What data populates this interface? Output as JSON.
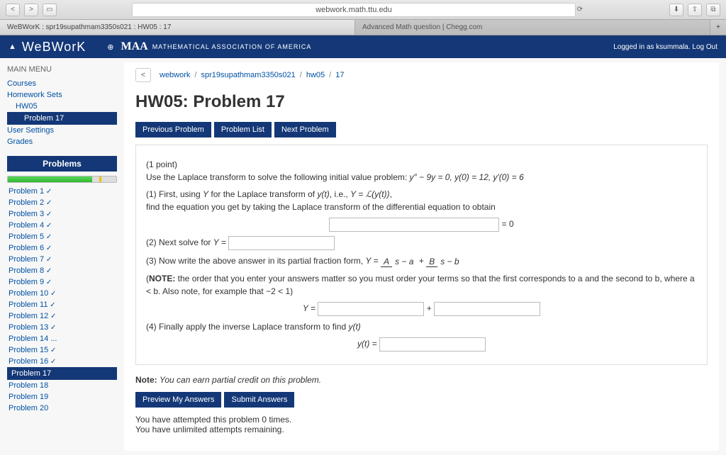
{
  "safari": {
    "url": "webwork.math.ttu.edu"
  },
  "tabs": {
    "t1": "WeBWorK : spr19supathmam3350s021 : HW05 : 17",
    "t2": "Advanced Math question | Chegg.com"
  },
  "header": {
    "logo": "WeBWorK",
    "maa": "MAA",
    "maaSub": "MATHEMATICAL ASSOCIATION OF AMERICA",
    "right": "Logged in as ksummala.    Log Out"
  },
  "breadcrumb": {
    "a": "webwork",
    "b": "spr19supathmam3350s021",
    "c": "hw05",
    "d": "17"
  },
  "title": "HW05: Problem 17",
  "nav": {
    "prev": "Previous Problem",
    "list": "Problem List",
    "next": "Next Problem"
  },
  "sidebar": {
    "mainmenu": "MAIN MENU",
    "courses": "Courses",
    "hwsets": "Homework Sets",
    "hw05": "HW05",
    "p17": "Problem 17",
    "usersettings": "User Settings",
    "grades": "Grades",
    "problemsHdr": "Problems"
  },
  "problems": {
    "p1": "Problem 1",
    "p2": "Problem 2",
    "p3": "Problem 3",
    "p4": "Problem 4",
    "p5": "Problem 5",
    "p6": "Problem 6",
    "p7": "Problem 7",
    "p8": "Problem 8",
    "p9": "Problem 9",
    "p10": "Problem 10",
    "p11": "Problem 11",
    "p12": "Problem 12",
    "p13": "Problem 13",
    "p14": "Problem 14",
    "p15": "Problem 15",
    "p16": "Problem 16",
    "p17": "Problem 17",
    "p18": "Problem 18",
    "p19": "Problem 19",
    "p20": "Problem 20"
  },
  "body": {
    "points": "(1 point)",
    "intro1": "Use the Laplace transform to solve the following initial value problem: ",
    "eq1": "y″ − 9y = 0,        y(0) = 12,  y′(0) = 6",
    "step1a": "(1) First, using ",
    "step1b": " for the Laplace transform of ",
    "step1c": ", i.e., ",
    "step1eq": "Y = ℒ(y(t))",
    "step1d": ",",
    "step1e": "find the equation you get by taking the Laplace transform of the differential equation to obtain",
    "eqzero": " = 0",
    "step2": "(2) Next solve for ",
    "step2eq": "Y = ",
    "step3a": "(3) Now write the above answer in its partial fraction form, ",
    "noteHdr": "NOTE:",
    "noteTxt": " the order that you enter your answers matter so you must order your terms so that the first corresponds to a and the second to b, where a < b. Also note, for example that −2 < 1)",
    "Yeq": "Y = ",
    "plus": " + ",
    "step4": "(4) Finally apply the inverse Laplace transform to find ",
    "yt": "y(t)",
    "yteq": "y(t) = ",
    "noteFooter": "You can earn partial credit on this problem.",
    "noteLbl": "Note: ",
    "preview": "Preview My Answers",
    "submit": "Submit Answers",
    "attempts1": "You have attempted this problem 0 times.",
    "attempts2": "You have unlimited attempts remaining."
  }
}
